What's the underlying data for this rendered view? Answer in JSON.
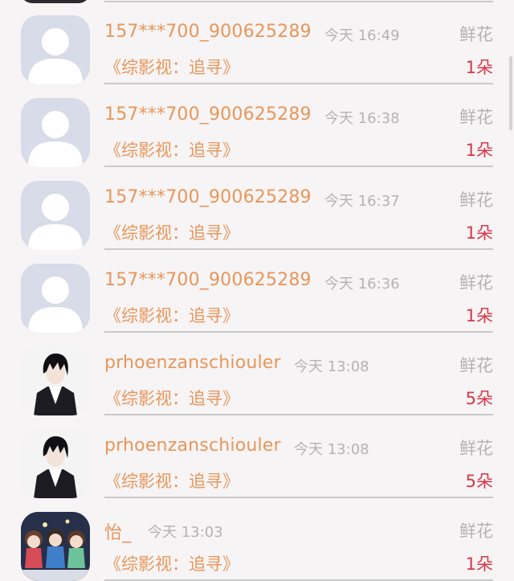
{
  "colors": {
    "background": "#f7f4f5",
    "name_text": "#e8965a",
    "meta_text": "#b3b3b3",
    "count_text": "#d9374a",
    "divider": "#c9c9c9",
    "default_avatar_bg": "#d8dbe8",
    "default_avatar_fg": "#ffffff"
  },
  "gift_records": [
    {
      "avatar": "default-person-icon",
      "name": "157***700_900625289",
      "time": "今天 16:49",
      "gift": "鲜花",
      "work": "《综影视：追寻》",
      "count": "1朵"
    },
    {
      "avatar": "default-person-icon",
      "name": "157***700_900625289",
      "time": "今天 16:38",
      "gift": "鲜花",
      "work": "《综影视：追寻》",
      "count": "1朵"
    },
    {
      "avatar": "default-person-icon",
      "name": "157***700_900625289",
      "time": "今天 16:37",
      "gift": "鲜花",
      "work": "《综影视：追寻》",
      "count": "1朵"
    },
    {
      "avatar": "default-person-icon",
      "name": "157***700_900625289",
      "time": "今天 16:36",
      "gift": "鲜花",
      "work": "《综影视：追寻》",
      "count": "1朵"
    },
    {
      "avatar": "anime-boy-avatar",
      "name": "prhoenzanschiouler",
      "time": "今天 13:08",
      "gift": "鲜花",
      "work": "《综影视：追寻》",
      "count": "5朵"
    },
    {
      "avatar": "anime-boy-avatar",
      "name": "prhoenzanschiouler",
      "time": "今天 13:08",
      "gift": "鲜花",
      "work": "《综影视：追寻》",
      "count": "5朵"
    },
    {
      "avatar": "chibi-group-avatar",
      "name": "怡_",
      "time": "今天 13:03",
      "gift": "鲜花",
      "work": "《综影视：追寻》",
      "count": "1朵"
    }
  ]
}
